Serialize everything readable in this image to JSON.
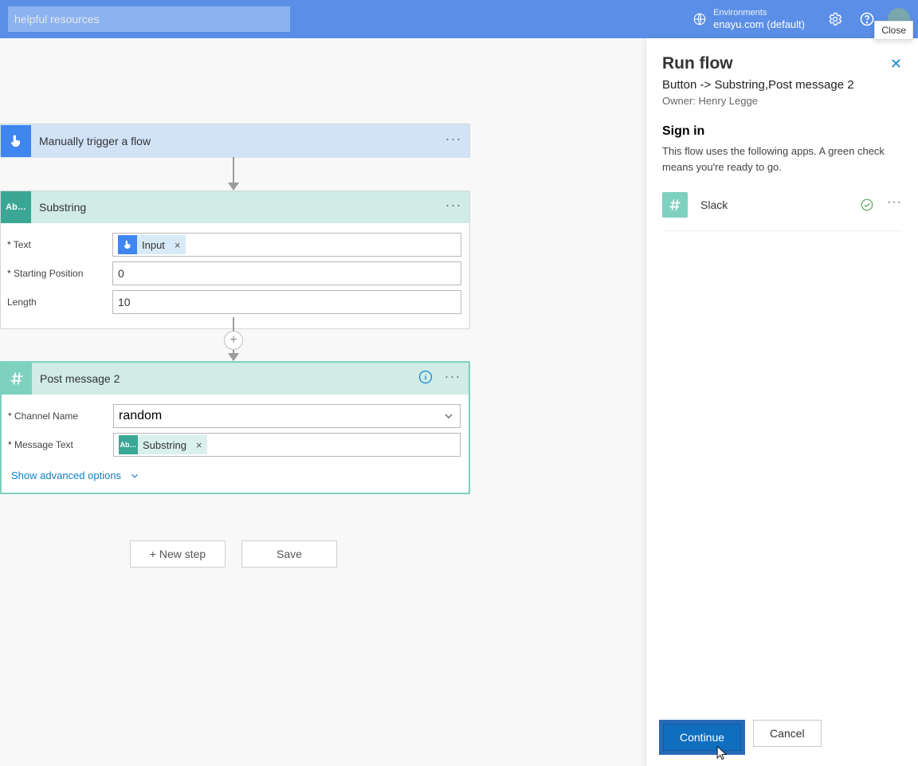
{
  "header": {
    "search_text": "helpful resources",
    "env_label": "Environments",
    "env_name": "enayu.com (default)",
    "close_tooltip": "Close"
  },
  "cards": {
    "trigger": {
      "title": "Manually trigger a flow"
    },
    "substring": {
      "title": "Substring",
      "fields": {
        "text": {
          "label": "Text",
          "token_label": "Input"
        },
        "start": {
          "label": "Starting Position",
          "value": "0"
        },
        "length": {
          "label": "Length",
          "value": "10"
        }
      }
    },
    "post": {
      "title": "Post message 2",
      "fields": {
        "channel": {
          "label": "Channel Name",
          "value": "random"
        },
        "msg": {
          "label": "Message Text",
          "token_label": "Substring"
        }
      },
      "advanced": "Show advanced options"
    }
  },
  "buttons": {
    "new_step": "+ New step",
    "save": "Save"
  },
  "panel": {
    "title": "Run flow",
    "subtitle": "Button -> Substring,Post message 2",
    "owner": "Owner: Henry Legge",
    "signin_title": "Sign in",
    "signin_text": "This flow uses the following apps. A green check means you're ready to go.",
    "conn_name": "Slack",
    "continue": "Continue",
    "cancel": "Cancel"
  }
}
